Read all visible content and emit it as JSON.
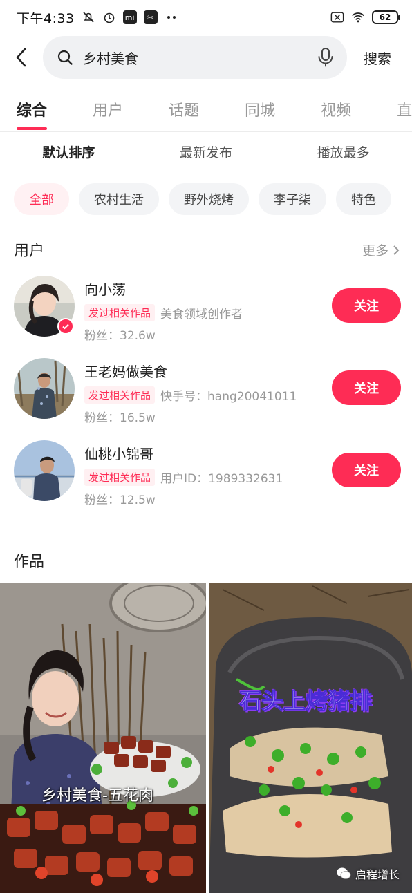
{
  "status_bar": {
    "time": "下午4:33",
    "battery": "62",
    "app_badge_mi": "mi",
    "app_badge_cap": "✂"
  },
  "search": {
    "query": "乡村美食",
    "submit_label": "搜索"
  },
  "tabs": [
    {
      "label": "综合",
      "active": true
    },
    {
      "label": "用户"
    },
    {
      "label": "话题"
    },
    {
      "label": "同城"
    },
    {
      "label": "视频"
    },
    {
      "label": "直"
    }
  ],
  "sort": [
    {
      "label": "默认排序",
      "active": true
    },
    {
      "label": "最新发布"
    },
    {
      "label": "播放最多"
    }
  ],
  "chips": [
    {
      "label": "全部",
      "active": true
    },
    {
      "label": "农村生活"
    },
    {
      "label": "野外烧烤"
    },
    {
      "label": "李子柒"
    },
    {
      "label": "特色"
    }
  ],
  "users_section": {
    "title": "用户",
    "more_label": "更多"
  },
  "users": [
    {
      "name": "向小荡",
      "tag": "发过相关作品",
      "desc": "美食领域创作者",
      "fans": "粉丝：32.6w",
      "follow_label": "关注"
    },
    {
      "name": "王老妈做美食",
      "tag": "发过相关作品",
      "desc": "快手号：hang20041011",
      "fans": "粉丝：16.5w",
      "follow_label": "关注"
    },
    {
      "name": "仙桃小锦哥",
      "tag": "发过相关作品",
      "desc": "用户ID：1989332631",
      "fans": "粉丝：12.5w",
      "follow_label": "关注"
    }
  ],
  "works_section": {
    "title": "作品"
  },
  "works": [
    {
      "caption": "乡村美食-五花肉"
    },
    {
      "caption": "石头上烤猪排"
    }
  ],
  "watermark": "启程增长",
  "colors": {
    "accent": "#fe2c55",
    "tag_bg": "#fff0f2",
    "chip_bg": "#f3f4f6"
  }
}
